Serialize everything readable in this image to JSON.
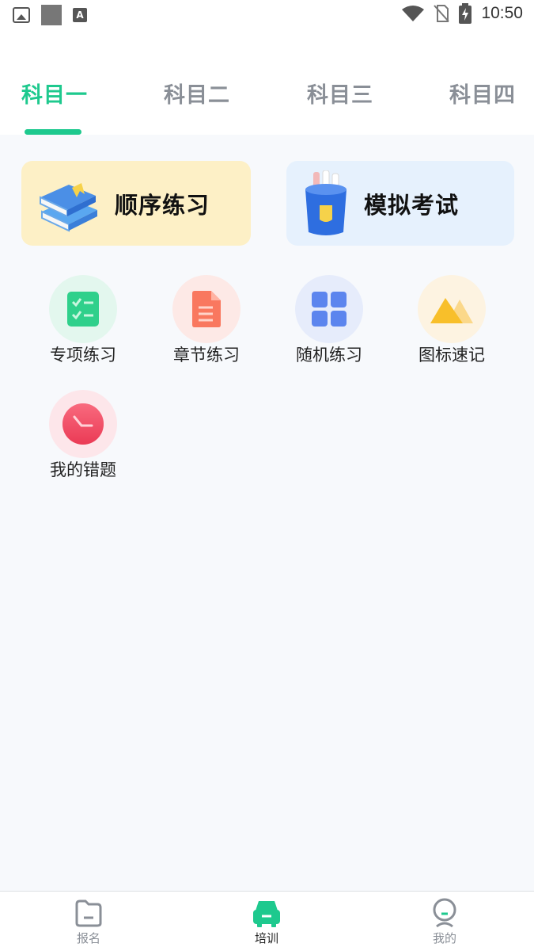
{
  "status_bar": {
    "time": "10:50",
    "notification_letter": "A",
    "icons": [
      "image-icon",
      "square-icon",
      "a-notification-icon",
      "wifi-icon",
      "no-sim-icon",
      "battery-charging-icon"
    ]
  },
  "tabs": [
    {
      "label": "科目一",
      "active": true
    },
    {
      "label": "科目二",
      "active": false
    },
    {
      "label": "科目三",
      "active": false
    },
    {
      "label": "科目四",
      "active": false
    }
  ],
  "cards": {
    "sequential": {
      "label": "顺序练习",
      "icon": "books-icon"
    },
    "mock_exam": {
      "label": "模拟考试",
      "icon": "pencil-cup-icon"
    }
  },
  "grid": [
    {
      "label": "专项练习",
      "icon": "checklist-icon"
    },
    {
      "label": "章节练习",
      "icon": "document-icon"
    },
    {
      "label": "随机练习",
      "icon": "grid-icon"
    },
    {
      "label": "图标速记",
      "icon": "mountain-icon"
    },
    {
      "label": "我的错题",
      "icon": "clock-icon"
    }
  ],
  "bottom_nav": [
    {
      "label": "报名",
      "icon": "folder-icon",
      "active": false
    },
    {
      "label": "培训",
      "icon": "car-icon",
      "active": true
    },
    {
      "label": "我的",
      "icon": "person-icon",
      "active": false
    }
  ],
  "colors": {
    "accent": "#1ec98e",
    "sequential_card_bg": "#fdf0c6",
    "exam_card_bg": "#e6f1fd",
    "tab_inactive": "#8a8f97"
  }
}
